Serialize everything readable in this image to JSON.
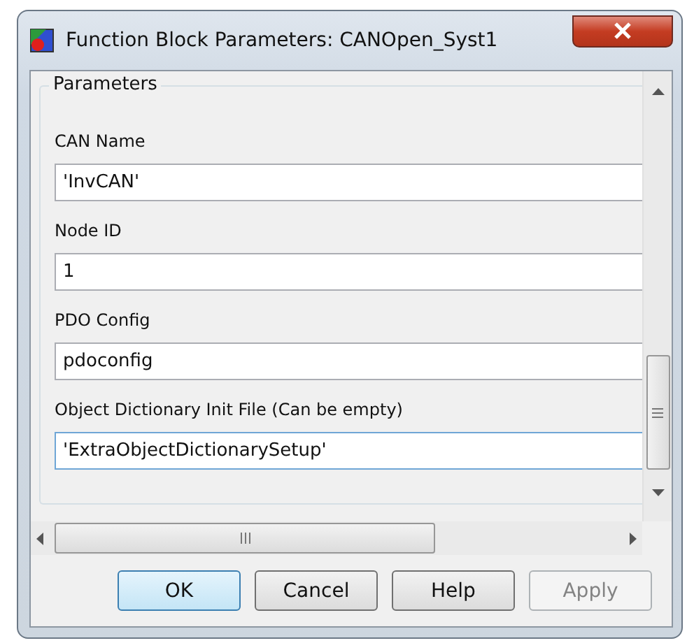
{
  "window": {
    "title": "Function Block Parameters: CANOpen_Syst1"
  },
  "group": {
    "title": "Parameters"
  },
  "fields": [
    {
      "label": "CAN Name",
      "value": "'InvCAN'",
      "focused": false
    },
    {
      "label": "Node ID",
      "value": "1",
      "focused": false
    },
    {
      "label": "PDO Config",
      "value": "pdoconfig",
      "focused": false
    },
    {
      "label": "Object Dictionary Init File (Can be empty)",
      "value": "'ExtraObjectDictionarySetup'",
      "focused": true
    }
  ],
  "buttons": [
    {
      "label": "OK",
      "default": true,
      "disabled": false
    },
    {
      "label": "Cancel",
      "default": false,
      "disabled": false
    },
    {
      "label": "Help",
      "default": false,
      "disabled": false
    },
    {
      "label": "Apply",
      "default": false,
      "disabled": true
    }
  ]
}
